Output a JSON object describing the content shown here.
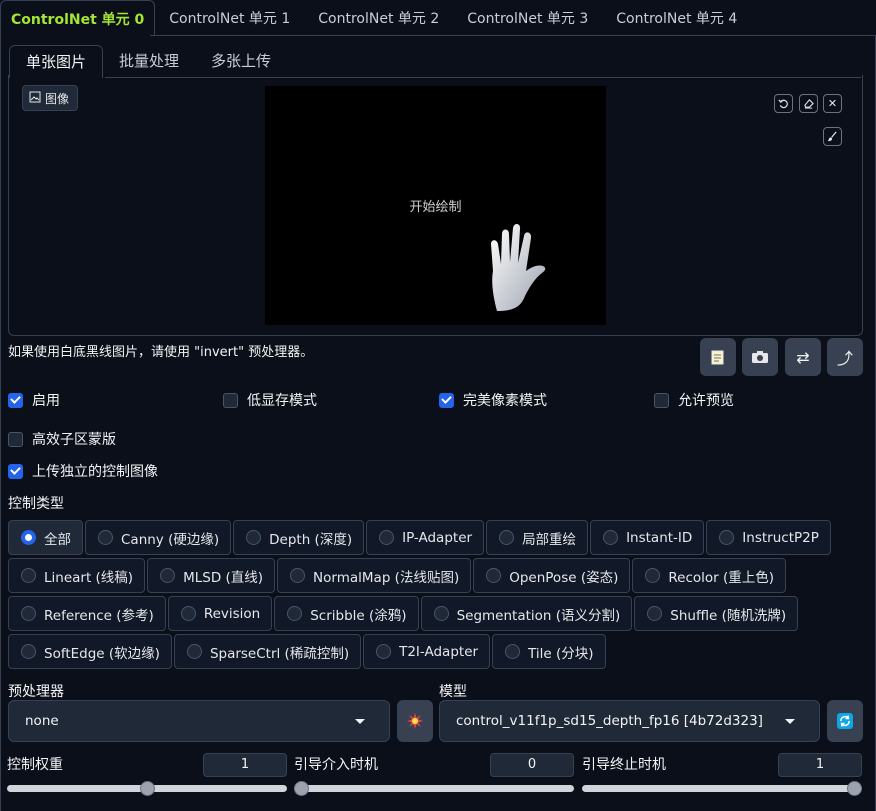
{
  "top_tabs": [
    "ControlNet 单元 0",
    "ControlNet 单元 1",
    "ControlNet 单元 2",
    "ControlNet 单元 3",
    "ControlNet 单元 4"
  ],
  "sub_tabs": [
    "单张图片",
    "批量处理",
    "多张上传"
  ],
  "image_panel": {
    "label": "图像",
    "canvas_text": "开始绘制"
  },
  "hint": "如果使用白底黑线图片，请使用 \"invert\" 预处理器。",
  "checkboxes": {
    "enable": {
      "label": "启用",
      "checked": true
    },
    "low_vram": {
      "label": "低显存模式",
      "checked": false
    },
    "pixel_perfect": {
      "label": "完美像素模式",
      "checked": true
    },
    "allow_preview": {
      "label": "允许预览",
      "checked": false
    },
    "efficient_mask": {
      "label": "高效子区蒙版",
      "checked": false
    },
    "upload_independent": {
      "label": "上传独立的控制图像",
      "checked": true
    }
  },
  "control_type": {
    "label": "控制类型",
    "rows": [
      [
        "全部",
        "Canny (硬边缘)",
        "Depth (深度)",
        "IP-Adapter",
        "局部重绘",
        "Instant-ID",
        "InstructP2P"
      ],
      [
        "Lineart (线稿)",
        "MLSD (直线)",
        "NormalMap (法线贴图)",
        "OpenPose (姿态)",
        "Recolor (重上色)"
      ],
      [
        "Reference (参考)",
        "Revision",
        "Scribble (涂鸦)",
        "Segmentation (语义分割)",
        "Shuffle (随机洗牌)"
      ],
      [
        "SoftEdge (软边缘)",
        "SparseCtrl (稀疏控制)",
        "T2I-Adapter",
        "Tile (分块)"
      ]
    ],
    "selected": "全部"
  },
  "preprocessor": {
    "label": "预处理器",
    "value": "none"
  },
  "model": {
    "label": "模型",
    "value": "control_v11f1p_sd15_depth_fp16 [4b72d323]"
  },
  "sliders": {
    "weight": {
      "label": "控制权重",
      "value": "1",
      "fraction": 0.5
    },
    "start": {
      "label": "引导介入时机",
      "value": "0",
      "fraction": 0.0
    },
    "end": {
      "label": "引导终止时机",
      "value": "1",
      "fraction": 1.0
    }
  }
}
